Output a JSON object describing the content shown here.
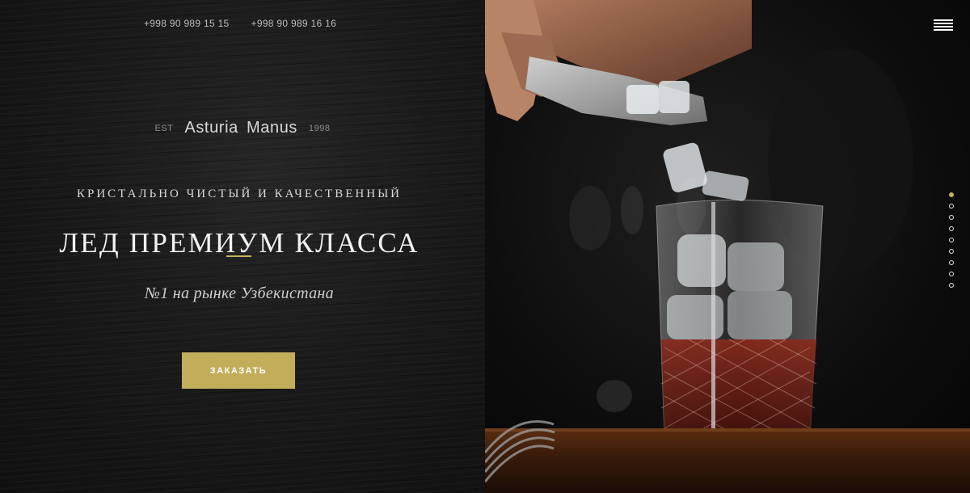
{
  "header": {
    "phones": [
      "+998 90 989 15 15",
      "+998 90 989 16 16"
    ]
  },
  "brand": {
    "est": "EST",
    "name": "Asturia Manus",
    "year": "1998"
  },
  "hero": {
    "subtitle": "КРИСТАЛЬНО ЧИСТЫЙ И КАЧЕСТВЕННЫЙ",
    "title": "ЛЕД ПРЕМИУМ КЛАССА",
    "tagline": "№1 на рынке Узбекистана",
    "button": "ЗАКАЗАТЬ"
  },
  "menu": {
    "icon": "hamburger-menu-icon"
  },
  "pagination": {
    "count": 9,
    "active": 1
  },
  "colors": {
    "accent": "#c8b15a",
    "background": "#161616",
    "text": "#f2f2f2"
  }
}
